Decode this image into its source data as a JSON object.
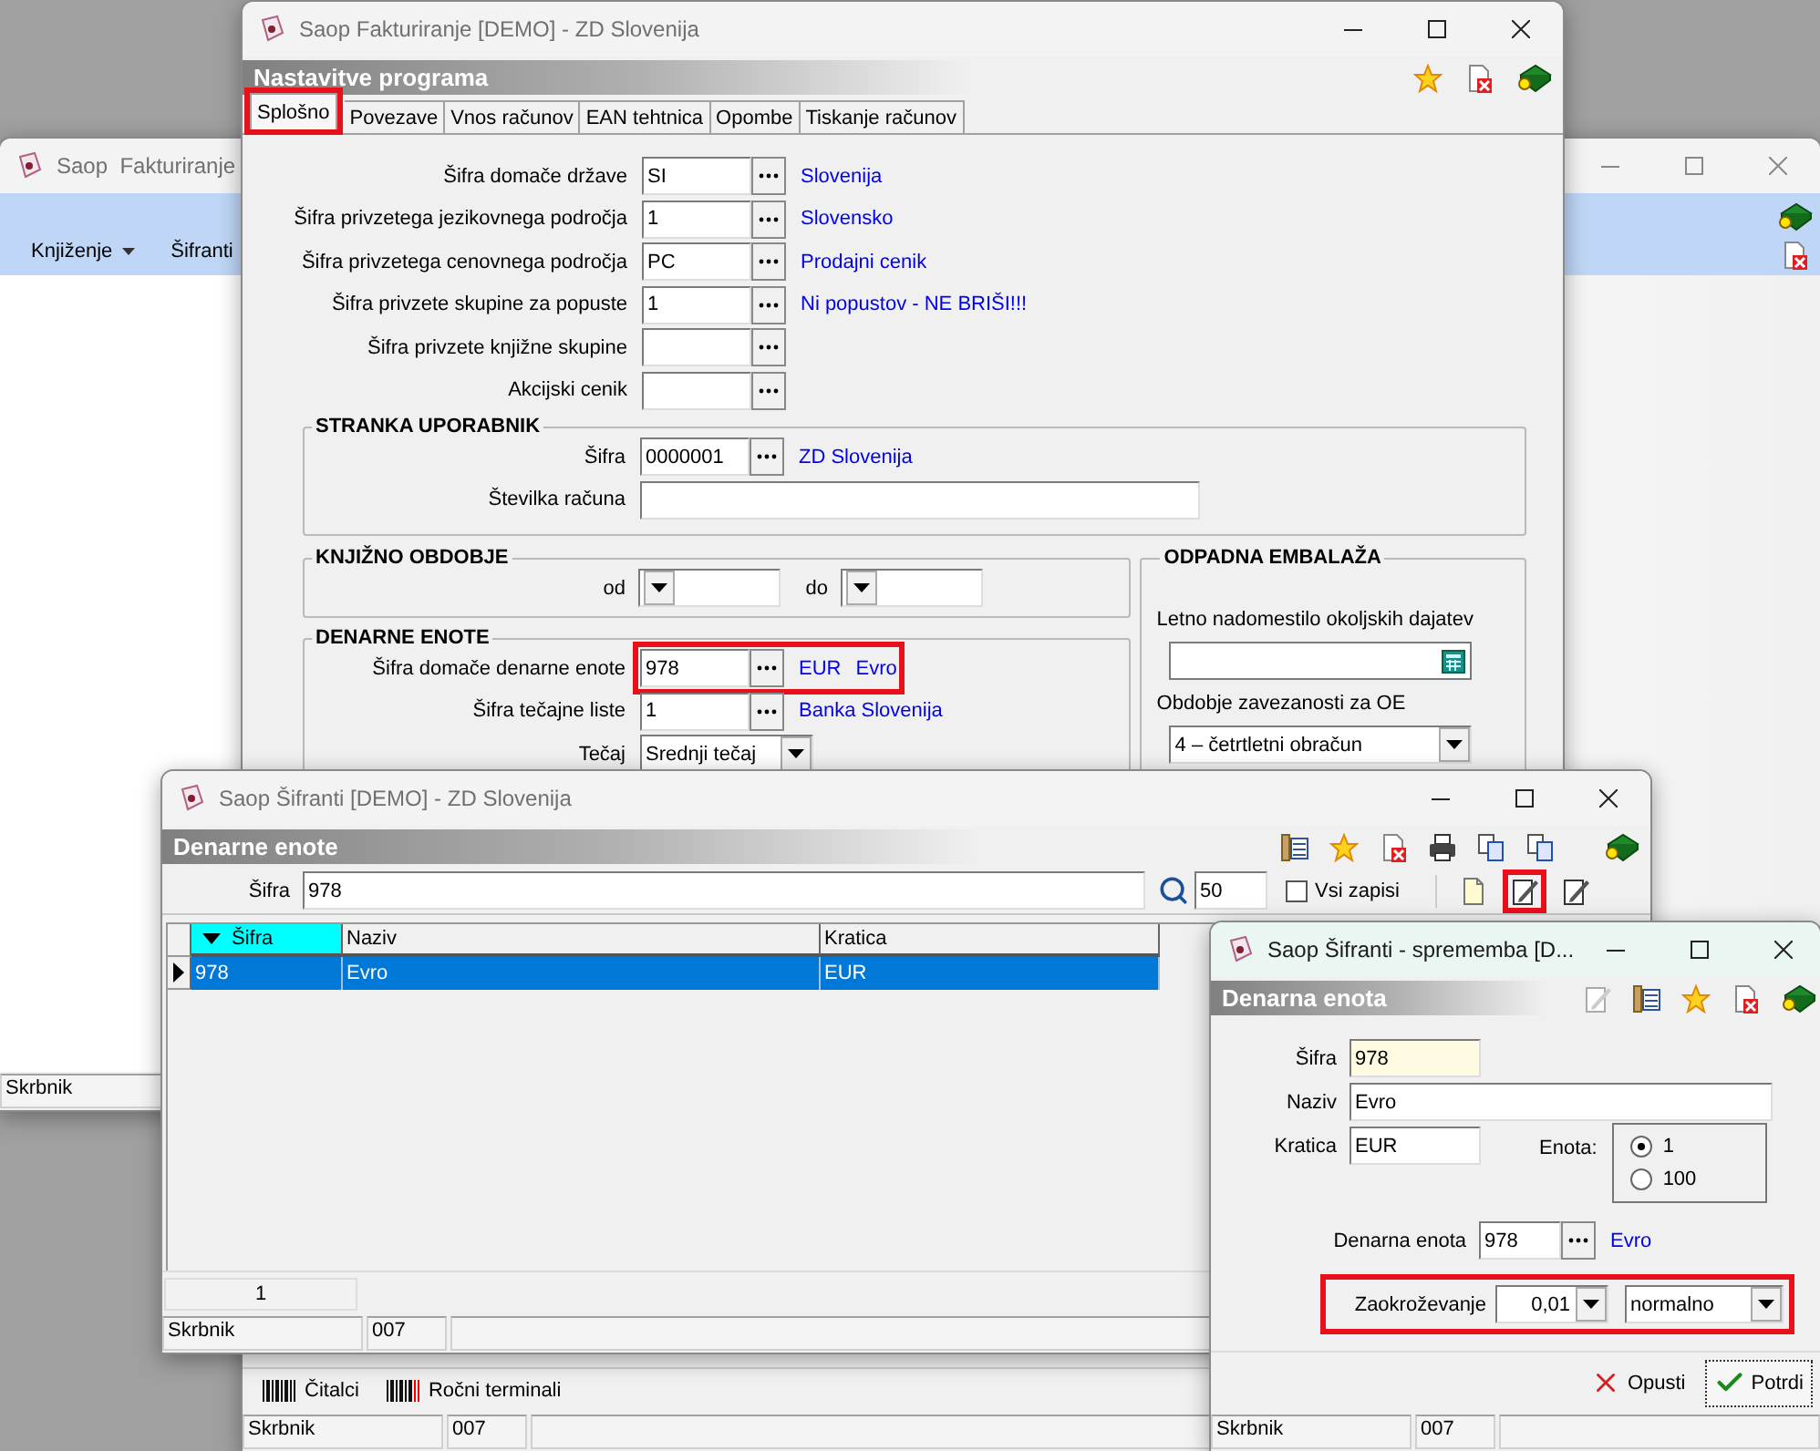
{
  "back_window": {
    "title": "Saop  Fakturiranje",
    "menu": [
      {
        "label": "Knjiženje",
        "dropdown": true
      },
      {
        "label": "Šifranti",
        "dropdown": false
      }
    ],
    "status_bar": [
      "Skrbnik"
    ]
  },
  "settings_window": {
    "title": "Saop Fakturiranje [DEMO] - ZD Slovenija",
    "header": "Nastavitve programa",
    "tabs": [
      {
        "label": "Splošno",
        "selected": true,
        "highlighted": true
      },
      {
        "label": "Povezave",
        "selected": false,
        "highlighted": false
      },
      {
        "label": "Vnos računov",
        "selected": false,
        "highlighted": false
      },
      {
        "label": "EAN tehtnica",
        "selected": false,
        "highlighted": false
      },
      {
        "label": "Opombe",
        "selected": false,
        "highlighted": false
      },
      {
        "label": "Tiskanje računov",
        "selected": false,
        "highlighted": false
      }
    ],
    "fields": [
      {
        "kind": "lookup",
        "label": "Šifra domače države",
        "value": "SI",
        "descriptions": [
          "Slovenija"
        ]
      },
      {
        "kind": "lookup",
        "label": "Šifra privzetega jezikovnega področja",
        "value": "1",
        "descriptions": [
          "Slovensko"
        ]
      },
      {
        "kind": "lookup",
        "label": "Šifra privzetega cenovnega področja",
        "value": "PC",
        "descriptions": [
          "Prodajni cenik"
        ]
      },
      {
        "kind": "lookup",
        "label": "Šifra privzete skupine za popuste",
        "value": "1",
        "descriptions": [
          "Ni popustov - NE BRIŠI!!!"
        ]
      },
      {
        "kind": "lookup",
        "label": "Šifra privzete knjižne skupine"
      },
      {
        "kind": "lookup",
        "label": "Akcijski cenik"
      }
    ],
    "user_group": {
      "title": "STRANKA UPORABNIK",
      "fields": [
        {
          "kind": "lookup",
          "label": "Šifra",
          "value": "0000001",
          "descriptions": [
            "ZD Slovenija"
          ]
        },
        {
          "kind": "text",
          "label": "Številka računa"
        }
      ]
    },
    "period_group": {
      "title": "KNJIŽNO OBDOBJE",
      "from_label": "od",
      "to_label": "do"
    },
    "currency_group": {
      "title": "DENARNE ENOTE",
      "fields": [
        {
          "kind": "lookup",
          "label": "Šifra domače denarne enote",
          "value": "978",
          "descriptions": [
            "EUR",
            "Evro"
          ],
          "highlighted": true
        },
        {
          "kind": "lookup",
          "label": "Šifra tečajne liste",
          "value": "1",
          "descriptions": [
            "Banka Slovenija"
          ],
          "highlighted": false
        },
        {
          "kind": "combo",
          "label": "Tečaj",
          "value": "Srednji tečaj",
          "highlighted": false
        }
      ]
    },
    "packaging_group": {
      "title": "ODPADNA EMBALAŽA",
      "fee_label": "Letno nadomestilo okoljskih dajatev",
      "period_label": "Obdobje zavezanosti za OE",
      "period_value": "4 – četrtletni obračun"
    },
    "bottom_buttons": [
      "Čitalci",
      "Ročni terminali"
    ],
    "status_bar": [
      "Skrbnik",
      "007"
    ]
  },
  "list_window": {
    "title": "Saop Šifranti [DEMO] - ZD Slovenija",
    "header": "Denarne enote",
    "search": {
      "label": "Šifra",
      "value": "978",
      "limit": "50",
      "all_records_label": "Vsi zapisi",
      "all_records_checked": false
    },
    "edit_highlighted": true,
    "columns": [
      {
        "label": "Šifra",
        "sorted": true
      },
      {
        "label": "Naziv",
        "sorted": false
      },
      {
        "label": "Kratica",
        "sorted": false
      }
    ],
    "rows": [
      {
        "cells": [
          "978",
          "Evro",
          "EUR"
        ],
        "selected": true
      }
    ],
    "record_count": "1",
    "status_bar": [
      "Skrbnik",
      "007"
    ]
  },
  "edit_window": {
    "title": "Saop Šifranti - sprememba [D...",
    "header": "Denarna enota",
    "code": {
      "label": "Šifra",
      "value": "978"
    },
    "name": {
      "label": "Naziv",
      "value": "Evro"
    },
    "abbreviation": {
      "label": "Kratica",
      "value": "EUR"
    },
    "unit": {
      "label": "Enota:",
      "options": [
        {
          "label": "1",
          "selected": true
        },
        {
          "label": "100",
          "selected": false
        }
      ]
    },
    "currency": {
      "label": "Denarna enota",
      "value": "978",
      "description": "Evro"
    },
    "rounding": {
      "label": "Zaokroževanje",
      "step": "0,01",
      "mode": "normalno",
      "highlighted": true
    },
    "buttons": [
      {
        "kind": "cancel",
        "label": "Opusti",
        "default": false
      },
      {
        "kind": "confirm",
        "label": "Potrdi",
        "default": true
      }
    ],
    "status_bar": [
      "Skrbnik",
      "007"
    ]
  }
}
